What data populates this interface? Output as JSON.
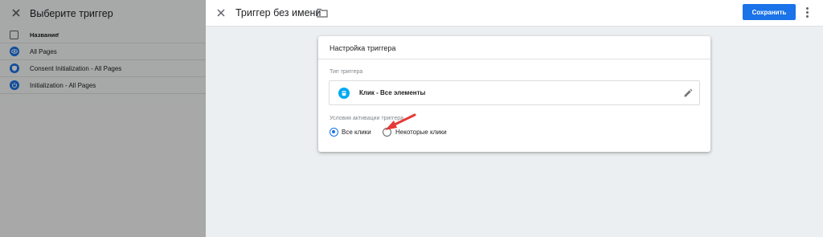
{
  "left_panel": {
    "title": "Выберите триггер",
    "column_header": "Название",
    "sort_icon": "arrow-up-icon",
    "rows": [
      {
        "label": "All Pages",
        "icon": "eye-icon"
      },
      {
        "label": "Consent Initialization - All Pages",
        "icon": "shield-icon"
      },
      {
        "label": "Initialization - All Pages",
        "icon": "power-icon"
      }
    ]
  },
  "header": {
    "title": "Триггер без имени",
    "save_label": "Сохранить"
  },
  "card": {
    "title": "Настройка триггера",
    "type_label": "Тип триггера",
    "type_name": "Клик - Все элементы",
    "activation_label": "Условия активации триггера",
    "radio_all": "Все клики",
    "radio_some": "Некоторые клики",
    "selected": "Все клики"
  },
  "colors": {
    "accent": "#1a73e8",
    "click_icon": "#03a9f4",
    "annotation_arrow": "#e53935"
  }
}
